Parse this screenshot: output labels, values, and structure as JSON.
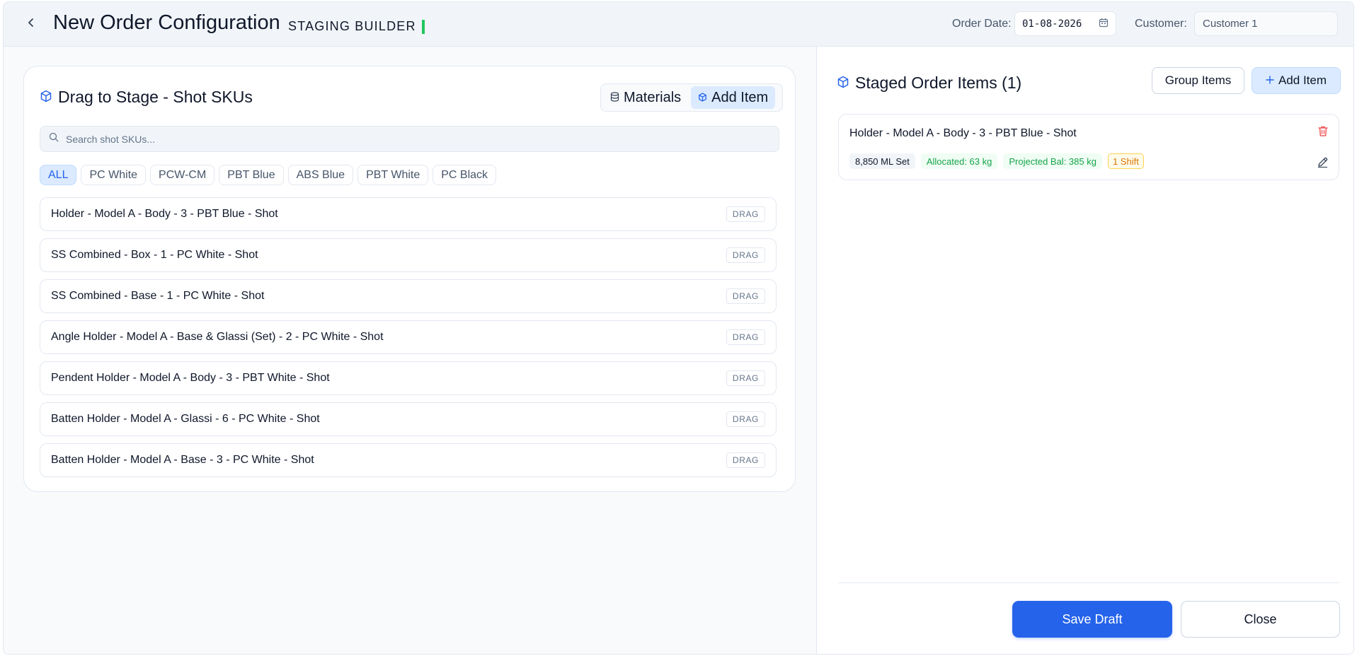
{
  "header": {
    "title": "New Order Configuration",
    "subtitle": "STAGING BUILDER",
    "order_date_label": "Order Date:",
    "order_date_value": "01-08-2026",
    "customer_label": "Customer:",
    "customer_value": "Customer 1"
  },
  "left": {
    "title": "Drag to Stage - Shot SKUs",
    "toggle": {
      "materials_label": "Materials",
      "add_item_label": "Add Item",
      "active": "add_item"
    },
    "search_placeholder": "Search shot SKUs...",
    "filters": [
      "ALL",
      "PC White",
      "PCW-CM",
      "PBT Blue",
      "ABS Blue",
      "PBT White",
      "PC Black"
    ],
    "active_filter": "ALL",
    "drag_tag": "DRAG",
    "items": [
      "Holder - Model A - Body - 3 - PBT Blue - Shot",
      "SS Combined - Box - 1 - PC White - Shot",
      "SS Combined - Base - 1 - PC White - Shot",
      "Angle Holder - Model A - Base & Glassi (Set) - 2 - PC White - Shot",
      "Pendent Holder - Model A - Body - 3 - PBT White - Shot",
      "Batten Holder - Model A - Glassi - 6 - PC White - Shot",
      "Batten Holder - Model A - Base - 3 - PC White - Shot"
    ]
  },
  "right": {
    "title": "Staged Order Items (1)",
    "group_items_label": "Group Items",
    "add_item_label": "Add Item",
    "staged_items": [
      {
        "name": "Holder - Model A - Body - 3 - PBT Blue - Shot",
        "set": "8,850 ML Set",
        "allocated": "Allocated: 63 kg",
        "projected": "Projected Bal: 385 kg",
        "shift": "1 Shift"
      }
    ],
    "save_draft_label": "Save Draft",
    "close_label": "Close"
  },
  "colors": {
    "accent": "#2563eb",
    "accent_soft": "#dbeafe",
    "success": "#16a34a",
    "warning": "#d97706",
    "danger": "#ef4444",
    "status_bar": "#22c55e"
  },
  "icons": {
    "back": "chevron-left-icon",
    "calendar": "calendar-icon",
    "cube": "cube-icon",
    "database": "database-icon",
    "search": "search-icon",
    "plus": "plus-icon",
    "trash": "trash-icon",
    "pencil": "pencil-icon"
  }
}
